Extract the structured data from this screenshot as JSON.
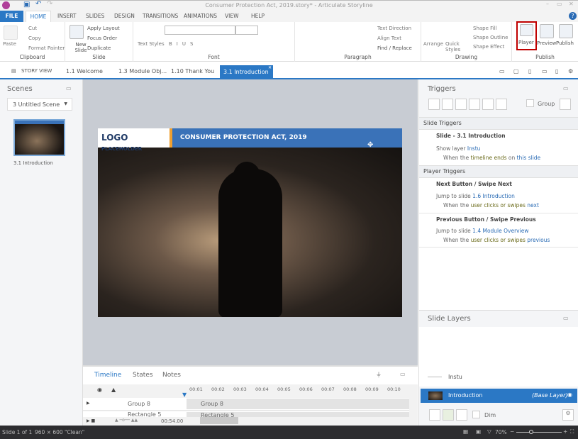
{
  "window": {
    "title": "Consumer Protection Act, 2019.story* - Articulate Storyline"
  },
  "ribbon_tabs": [
    "FILE",
    "HOME",
    "INSERT",
    "SLIDES",
    "DESIGN",
    "TRANSITIONS",
    "ANIMATIONS",
    "VIEW",
    "HELP"
  ],
  "clipboard": {
    "paste": "Paste",
    "cut": "Cut",
    "copy": "Copy",
    "format_painter": "Format Painter",
    "label": "Clipboard"
  },
  "slide_group": {
    "new_slide": "New Slide",
    "apply_layout": "Apply Layout",
    "focus_order": "Focus Order",
    "duplicate": "Duplicate",
    "label": "Slide"
  },
  "font_group": {
    "text_styles": "Text Styles",
    "label": "Font"
  },
  "paragraph": {
    "text_direction": "Text Direction",
    "align_text": "Align Text",
    "find_replace": "Find / Replace",
    "label": "Paragraph"
  },
  "drawing": {
    "arrange": "Arrange",
    "quick_styles": "Quick Styles",
    "shape_fill": "Shape Fill",
    "shape_outline": "Shape Outline",
    "shape_effect": "Shape Effect",
    "label": "Drawing"
  },
  "publish": {
    "player": "Player",
    "preview": "Preview",
    "publish": "Publish",
    "label": "Publish"
  },
  "story_tabs": {
    "story_view": "STORY VIEW",
    "tabs": [
      "1.1 Welcome",
      "1.3 Module Obj...",
      "1.10 Thank You"
    ],
    "active": "3.1 Introduction"
  },
  "scenes": {
    "title": "Scenes",
    "selected": "3 Untitled Scene",
    "thumb_label": "3.1 Introduction"
  },
  "slide": {
    "logo_main": "LOGO",
    "logo_sub": "PLACEHOLDER",
    "header": "CONSUMER PROTECTION ACT, 2019",
    "header_color": "#3a72b8",
    "accent": "#f0a030"
  },
  "timeline": {
    "tabs": [
      "Timeline",
      "States",
      "Notes"
    ],
    "ticks": [
      "00:01",
      "00:02",
      "00:03",
      "00:04",
      "00:05",
      "00:06",
      "00:07",
      "00:08",
      "00:09",
      "00:10"
    ],
    "rows": [
      "Group 8",
      "Rectangle 5"
    ],
    "duration": "00:54.00"
  },
  "triggers": {
    "title": "Triggers",
    "group_label": "Group",
    "slide_triggers": "Slide Triggers",
    "slide_item": "Slide - 3.1 Introduction",
    "t1_action": "Show layer",
    "t1_target": "Instu",
    "t1_when": "When the",
    "t1_event": "timeline ends",
    "t1_on": "on",
    "t1_obj": "this slide",
    "player_triggers": "Player Triggers",
    "next": "Next Button / Swipe Next",
    "t2_action": "Jump to slide",
    "t2_target": "1.6 Introduction",
    "t2_when": "When the",
    "t2_user": "user",
    "t2_event": "clicks or swipes",
    "t2_dir": "next",
    "prev": "Previous Button / Swipe Previous",
    "t3_action": "Jump to slide",
    "t3_target": "1.4 Module Overview",
    "t3_when": "When the",
    "t3_user": "user",
    "t3_event": "clicks or swipes",
    "t3_dir": "previous"
  },
  "layers": {
    "title": "Slide Layers",
    "items": [
      "Instu"
    ],
    "base": "Introduction",
    "base_tag": "(Base Layer)",
    "dim": "Dim"
  },
  "status": {
    "slide": "Slide 1 of 1",
    "size": "960 × 600",
    "theme": "\"Clean\"",
    "zoom": "70%"
  }
}
